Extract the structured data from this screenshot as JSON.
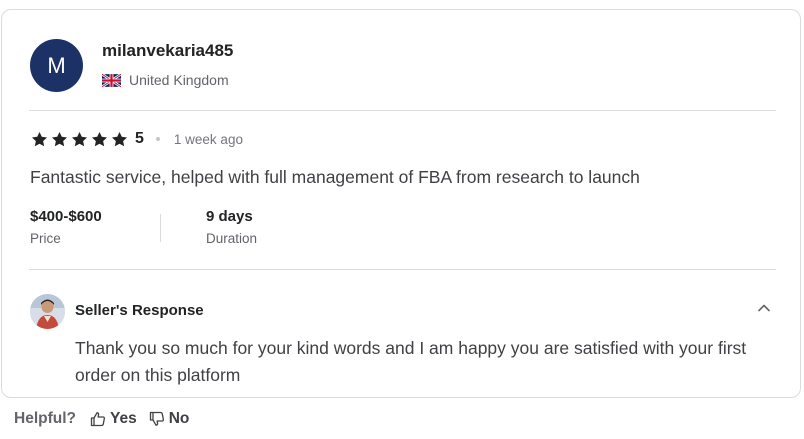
{
  "reviewer": {
    "avatar_initial": "M",
    "username": "milanvekaria485",
    "country": "United Kingdom",
    "flag_icon": "uk-flag-icon"
  },
  "rating": {
    "stars": 5,
    "value": "5",
    "time_ago": "1 week ago"
  },
  "review": {
    "text": "Fantastic service, helped with full management of FBA from research to launch"
  },
  "details": {
    "price_value": "$400-$600",
    "price_label": "Price",
    "duration_value": "9 days",
    "duration_label": "Duration"
  },
  "seller_response": {
    "title": "Seller's Response",
    "text": "Thank you so much for your kind words and I am happy you are satisfied with your first order on this platform"
  },
  "helpful": {
    "label": "Helpful?",
    "yes_label": "Yes",
    "no_label": "No"
  },
  "colors": {
    "avatar_bg": "#1c3266",
    "border": "#dadbdd",
    "text_primary": "#222325",
    "text_secondary": "#62646a"
  }
}
